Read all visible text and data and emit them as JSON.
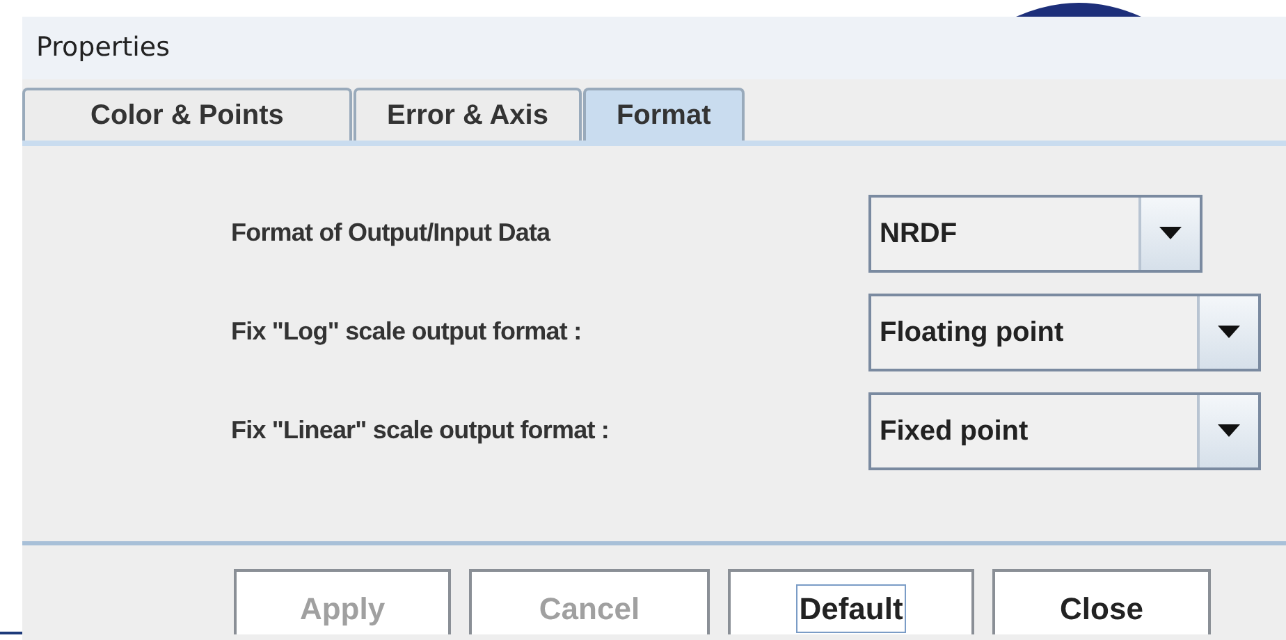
{
  "window": {
    "title": "Properties"
  },
  "tabs": [
    {
      "label": "Color & Points",
      "selected": false
    },
    {
      "label": "Error & Axis",
      "selected": false
    },
    {
      "label": "Format",
      "selected": true
    }
  ],
  "fields": [
    {
      "label": "Format of Output/Input Data",
      "value": "NRDF"
    },
    {
      "label": "Fix \"Log\" scale output format :",
      "value": "Floating point"
    },
    {
      "label": "Fix \"Linear\" scale output format :",
      "value": "Fixed point"
    }
  ],
  "buttons": [
    {
      "label": "Apply",
      "disabled": true,
      "focused": false
    },
    {
      "label": "Cancel",
      "disabled": true,
      "focused": false
    },
    {
      "label": "Default",
      "disabled": false,
      "focused": true
    },
    {
      "label": "Close",
      "disabled": false,
      "focused": false
    }
  ]
}
